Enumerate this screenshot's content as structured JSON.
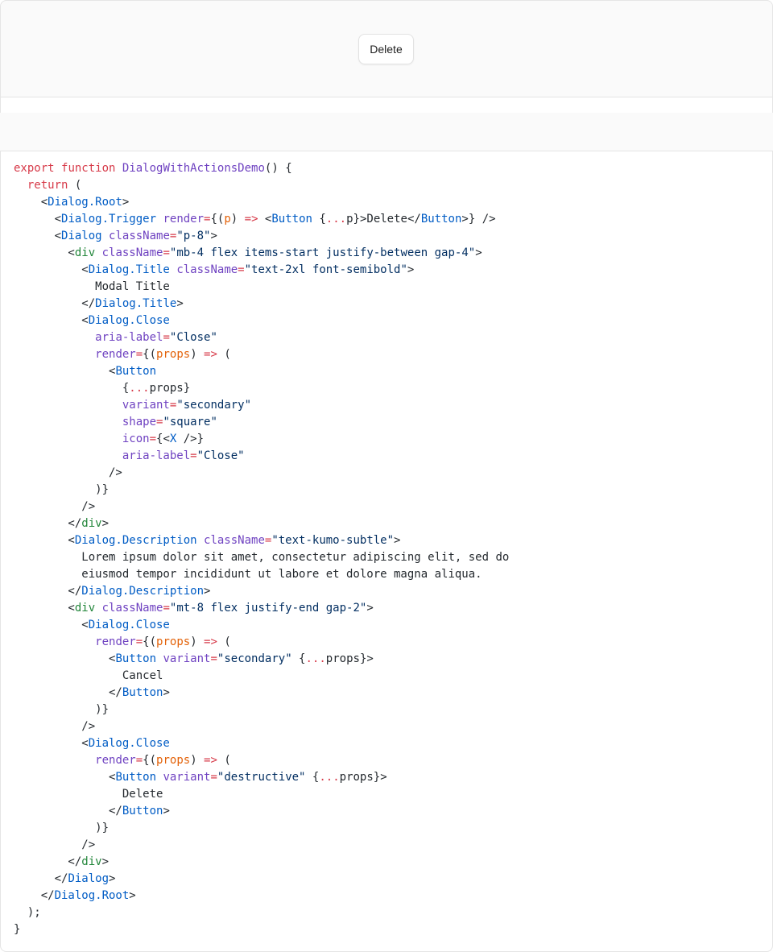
{
  "preview": {
    "trigger_label": "Delete"
  },
  "colors": {
    "keyword": "#d73a49",
    "function": "#6f42c1",
    "component_tag": "#005cc5",
    "html_tag": "#22863a",
    "attribute": "#6f42c1",
    "string": "#032f62",
    "parameter": "#e36209",
    "text": "#24292e"
  },
  "code": {
    "language": "tsx",
    "lines": [
      [
        [
          "kw",
          "export"
        ],
        [
          "punc",
          " "
        ],
        [
          "kw",
          "function"
        ],
        [
          "punc",
          " "
        ],
        [
          "fn",
          "DialogWithActionsDemo"
        ],
        [
          "punc",
          "() {"
        ]
      ],
      [
        [
          "punc",
          "  "
        ],
        [
          "kw",
          "return"
        ],
        [
          "punc",
          " ("
        ]
      ],
      [
        [
          "punc",
          "    <"
        ],
        [
          "tag",
          "Dialog.Root"
        ],
        [
          "punc",
          ">"
        ]
      ],
      [
        [
          "punc",
          "      <"
        ],
        [
          "tag",
          "Dialog.Trigger"
        ],
        [
          "punc",
          " "
        ],
        [
          "attr",
          "render"
        ],
        [
          "kw",
          "="
        ],
        [
          "punc",
          "{("
        ],
        [
          "param",
          "p"
        ],
        [
          "punc",
          ") "
        ],
        [
          "kw",
          "=>"
        ],
        [
          "punc",
          " <"
        ],
        [
          "tag",
          "Button"
        ],
        [
          "punc",
          " {"
        ],
        [
          "kw",
          "..."
        ],
        [
          "ident",
          "p"
        ],
        [
          "punc",
          "}>"
        ],
        [
          "text",
          "Delete"
        ],
        [
          "punc",
          "</"
        ],
        [
          "tag",
          "Button"
        ],
        [
          "punc",
          ">} />"
        ]
      ],
      [
        [
          "punc",
          "      <"
        ],
        [
          "tag",
          "Dialog"
        ],
        [
          "punc",
          " "
        ],
        [
          "attr",
          "className"
        ],
        [
          "kw",
          "="
        ],
        [
          "str",
          "\"p-8\""
        ],
        [
          "punc",
          ">"
        ]
      ],
      [
        [
          "punc",
          "        <"
        ],
        [
          "html",
          "div"
        ],
        [
          "punc",
          " "
        ],
        [
          "attr",
          "className"
        ],
        [
          "kw",
          "="
        ],
        [
          "str",
          "\"mb-4 flex items-start justify-between gap-4\""
        ],
        [
          "punc",
          ">"
        ]
      ],
      [
        [
          "punc",
          "          <"
        ],
        [
          "tag",
          "Dialog.Title"
        ],
        [
          "punc",
          " "
        ],
        [
          "attr",
          "className"
        ],
        [
          "kw",
          "="
        ],
        [
          "str",
          "\"text-2xl font-semibold\""
        ],
        [
          "punc",
          ">"
        ]
      ],
      [
        [
          "text",
          "            Modal Title"
        ]
      ],
      [
        [
          "punc",
          "          </"
        ],
        [
          "tag",
          "Dialog.Title"
        ],
        [
          "punc",
          ">"
        ]
      ],
      [
        [
          "punc",
          "          <"
        ],
        [
          "tag",
          "Dialog.Close"
        ]
      ],
      [
        [
          "punc",
          "            "
        ],
        [
          "attr",
          "aria-label"
        ],
        [
          "kw",
          "="
        ],
        [
          "str",
          "\"Close\""
        ]
      ],
      [
        [
          "punc",
          "            "
        ],
        [
          "attr",
          "render"
        ],
        [
          "kw",
          "="
        ],
        [
          "punc",
          "{("
        ],
        [
          "param",
          "props"
        ],
        [
          "punc",
          ") "
        ],
        [
          "kw",
          "=>"
        ],
        [
          "punc",
          " ("
        ]
      ],
      [
        [
          "punc",
          "              <"
        ],
        [
          "tag",
          "Button"
        ]
      ],
      [
        [
          "punc",
          "                {"
        ],
        [
          "kw",
          "..."
        ],
        [
          "ident",
          "props"
        ],
        [
          "punc",
          "}"
        ]
      ],
      [
        [
          "punc",
          "                "
        ],
        [
          "attr",
          "variant"
        ],
        [
          "kw",
          "="
        ],
        [
          "str",
          "\"secondary\""
        ]
      ],
      [
        [
          "punc",
          "                "
        ],
        [
          "attr",
          "shape"
        ],
        [
          "kw",
          "="
        ],
        [
          "str",
          "\"square\""
        ]
      ],
      [
        [
          "punc",
          "                "
        ],
        [
          "attr",
          "icon"
        ],
        [
          "kw",
          "="
        ],
        [
          "punc",
          "{<"
        ],
        [
          "tag",
          "X"
        ],
        [
          "punc",
          " />}"
        ]
      ],
      [
        [
          "punc",
          "                "
        ],
        [
          "attr",
          "aria-label"
        ],
        [
          "kw",
          "="
        ],
        [
          "str",
          "\"Close\""
        ]
      ],
      [
        [
          "punc",
          "              />"
        ]
      ],
      [
        [
          "punc",
          "            )}"
        ]
      ],
      [
        [
          "punc",
          "          />"
        ]
      ],
      [
        [
          "punc",
          "        </"
        ],
        [
          "html",
          "div"
        ],
        [
          "punc",
          ">"
        ]
      ],
      [
        [
          "punc",
          "        <"
        ],
        [
          "tag",
          "Dialog.Description"
        ],
        [
          "punc",
          " "
        ],
        [
          "attr",
          "className"
        ],
        [
          "kw",
          "="
        ],
        [
          "str",
          "\"text-kumo-subtle\""
        ],
        [
          "punc",
          ">"
        ]
      ],
      [
        [
          "text",
          "          Lorem ipsum dolor sit amet, consectetur adipiscing elit, sed do"
        ]
      ],
      [
        [
          "text",
          "          eiusmod tempor incididunt ut labore et dolore magna aliqua."
        ]
      ],
      [
        [
          "punc",
          "        </"
        ],
        [
          "tag",
          "Dialog.Description"
        ],
        [
          "punc",
          ">"
        ]
      ],
      [
        [
          "punc",
          "        <"
        ],
        [
          "html",
          "div"
        ],
        [
          "punc",
          " "
        ],
        [
          "attr",
          "className"
        ],
        [
          "kw",
          "="
        ],
        [
          "str",
          "\"mt-8 flex justify-end gap-2\""
        ],
        [
          "punc",
          ">"
        ]
      ],
      [
        [
          "punc",
          "          <"
        ],
        [
          "tag",
          "Dialog.Close"
        ]
      ],
      [
        [
          "punc",
          "            "
        ],
        [
          "attr",
          "render"
        ],
        [
          "kw",
          "="
        ],
        [
          "punc",
          "{("
        ],
        [
          "param",
          "props"
        ],
        [
          "punc",
          ") "
        ],
        [
          "kw",
          "=>"
        ],
        [
          "punc",
          " ("
        ]
      ],
      [
        [
          "punc",
          "              <"
        ],
        [
          "tag",
          "Button"
        ],
        [
          "punc",
          " "
        ],
        [
          "attr",
          "variant"
        ],
        [
          "kw",
          "="
        ],
        [
          "str",
          "\"secondary\""
        ],
        [
          "punc",
          " {"
        ],
        [
          "kw",
          "..."
        ],
        [
          "ident",
          "props"
        ],
        [
          "punc",
          "}>"
        ]
      ],
      [
        [
          "text",
          "                Cancel"
        ]
      ],
      [
        [
          "punc",
          "              </"
        ],
        [
          "tag",
          "Button"
        ],
        [
          "punc",
          ">"
        ]
      ],
      [
        [
          "punc",
          "            )}"
        ]
      ],
      [
        [
          "punc",
          "          />"
        ]
      ],
      [
        [
          "punc",
          "          <"
        ],
        [
          "tag",
          "Dialog.Close"
        ]
      ],
      [
        [
          "punc",
          "            "
        ],
        [
          "attr",
          "render"
        ],
        [
          "kw",
          "="
        ],
        [
          "punc",
          "{("
        ],
        [
          "param",
          "props"
        ],
        [
          "punc",
          ") "
        ],
        [
          "kw",
          "=>"
        ],
        [
          "punc",
          " ("
        ]
      ],
      [
        [
          "punc",
          "              <"
        ],
        [
          "tag",
          "Button"
        ],
        [
          "punc",
          " "
        ],
        [
          "attr",
          "variant"
        ],
        [
          "kw",
          "="
        ],
        [
          "str",
          "\"destructive\""
        ],
        [
          "punc",
          " {"
        ],
        [
          "kw",
          "..."
        ],
        [
          "ident",
          "props"
        ],
        [
          "punc",
          "}>"
        ]
      ],
      [
        [
          "text",
          "                Delete"
        ]
      ],
      [
        [
          "punc",
          "              </"
        ],
        [
          "tag",
          "Button"
        ],
        [
          "punc",
          ">"
        ]
      ],
      [
        [
          "punc",
          "            )}"
        ]
      ],
      [
        [
          "punc",
          "          />"
        ]
      ],
      [
        [
          "punc",
          "        </"
        ],
        [
          "html",
          "div"
        ],
        [
          "punc",
          ">"
        ]
      ],
      [
        [
          "punc",
          "      </"
        ],
        [
          "tag",
          "Dialog"
        ],
        [
          "punc",
          ">"
        ]
      ],
      [
        [
          "punc",
          "    </"
        ],
        [
          "tag",
          "Dialog.Root"
        ],
        [
          "punc",
          ">"
        ]
      ],
      [
        [
          "punc",
          "  );"
        ]
      ],
      [
        [
          "punc",
          "}"
        ]
      ]
    ]
  }
}
